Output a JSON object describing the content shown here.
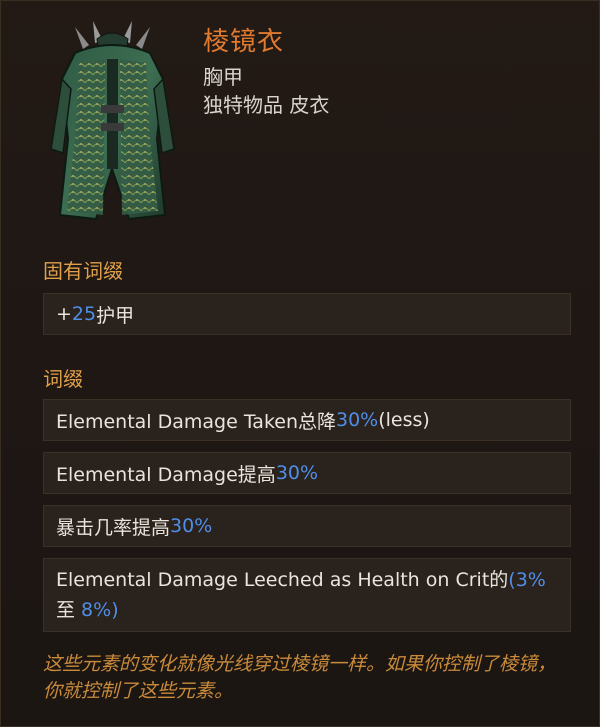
{
  "item": {
    "name": "棱镜衣",
    "slot": "胸甲",
    "rarity_type": "独特物品 皮衣"
  },
  "implicit": {
    "title": "固有词缀",
    "lines": [
      {
        "prefix": "+",
        "value": "25",
        "text": " 护甲"
      }
    ]
  },
  "affixes": {
    "title": "词缀",
    "lines": [
      {
        "text_a": "Elemental Damage Taken总降",
        "value": "30%",
        "text_b": " (less)"
      },
      {
        "text_a": "Elemental Damage提高",
        "value": "30%"
      },
      {
        "text_a": "暴击几率提高",
        "value": "30%"
      },
      {
        "text_a": "Elemental Damage Leeched as Health on Crit的",
        "value_a": "(3%",
        "mid": "至 ",
        "value_b": "8%)"
      }
    ]
  },
  "flavor": "这些元素的变化就像光线穿过棱镜一样。如果你控制了棱镜，你就控制了这些元素。",
  "colors": {
    "name": "#e07a2e",
    "section": "#e0a04a",
    "number": "#4f8ee8",
    "flavor": "#c98a3a",
    "box_bg": "#2a221d"
  },
  "icons": {
    "portrait": "leather-coat-icon"
  }
}
